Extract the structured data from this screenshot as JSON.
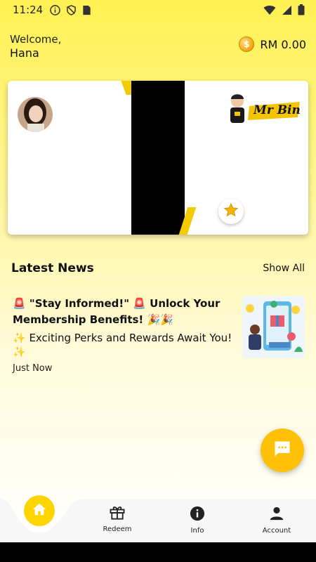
{
  "status_bar": {
    "time": "11:24"
  },
  "header": {
    "welcome": "Welcome,",
    "user_name": "Hana",
    "balance": "RM 0.00"
  },
  "card": {
    "brand": "Mr Bin"
  },
  "news": {
    "section_title": "Latest News",
    "show_all": "Show All",
    "items": [
      {
        "headline": "🚨 \"Stay Informed!\" 🚨 Unlock Your Membership Benefits! 🎉🎉",
        "subtitle": "✨ Exciting Perks and Rewards Await You! ✨",
        "time": "Just Now"
      }
    ]
  },
  "bottom_nav": {
    "items": [
      {
        "label": "Redeem",
        "icon": "gift-icon"
      },
      {
        "label": "Info",
        "icon": "info-icon"
      },
      {
        "label": "Account",
        "icon": "account-icon"
      }
    ]
  },
  "colors": {
    "accent": "#FFD400",
    "fab": "#FFC107",
    "band": "#000000",
    "stripe": "#F2CC00"
  }
}
